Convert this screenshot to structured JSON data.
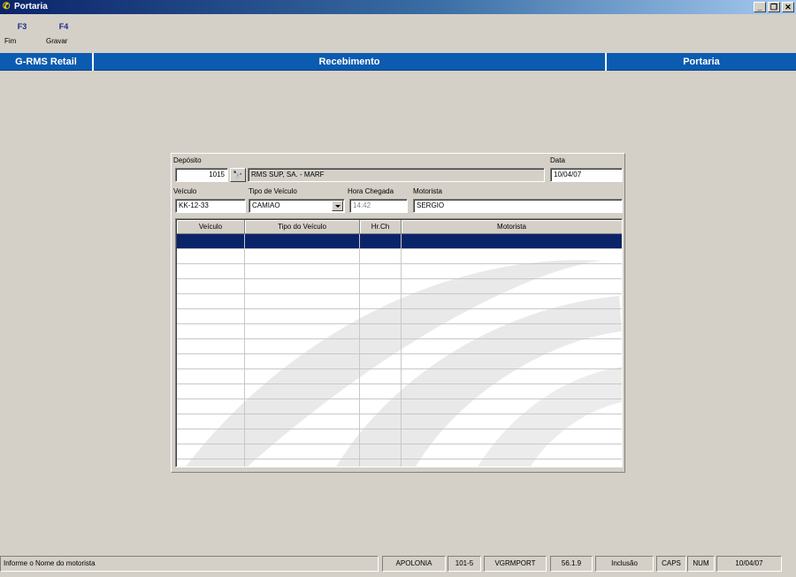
{
  "window": {
    "title": "Portaria",
    "icon": "phone-handset-icon",
    "controls": [
      "minimize",
      "restore",
      "close"
    ]
  },
  "toolbar": {
    "keys": [
      {
        "key": "F3",
        "label": "Fim"
      },
      {
        "key": "F4",
        "label": "Gravar"
      }
    ]
  },
  "module_bar": {
    "app": "G-RMS Retail",
    "module": "Recebimento",
    "screen": "Portaria",
    "color": "#0b5bb0"
  },
  "form": {
    "deposito": {
      "label": "Depósito",
      "code": "1015",
      "name": "RMS SUP, SA. - MARF"
    },
    "data": {
      "label": "Data",
      "value": "10/04/07"
    },
    "veiculo": {
      "label": "Veículo",
      "value": "KK-12-33"
    },
    "tipo_veiculo": {
      "label": "Tipo de Veículo",
      "value": "CAMIAO"
    },
    "hora_chegada": {
      "label": "Hora Chegada",
      "value": "14:42"
    },
    "motorista": {
      "label": "Motorista",
      "value": "SERGIO"
    }
  },
  "grid": {
    "columns": [
      "Veículo",
      "Tipo do Veículo",
      "Hr.Ch",
      "Motorista"
    ],
    "selected_row": 0,
    "selection_color": "#0a246a",
    "rows": []
  },
  "status_bar": {
    "message": "Informe o Nome do motorista",
    "user": "APOLONIA",
    "code": "101-5",
    "program": "VGRMPORT",
    "version": "56.1.9",
    "mode": "Inclusão",
    "caps": "CAPS",
    "num": "NUM",
    "date": "10/04/07"
  }
}
